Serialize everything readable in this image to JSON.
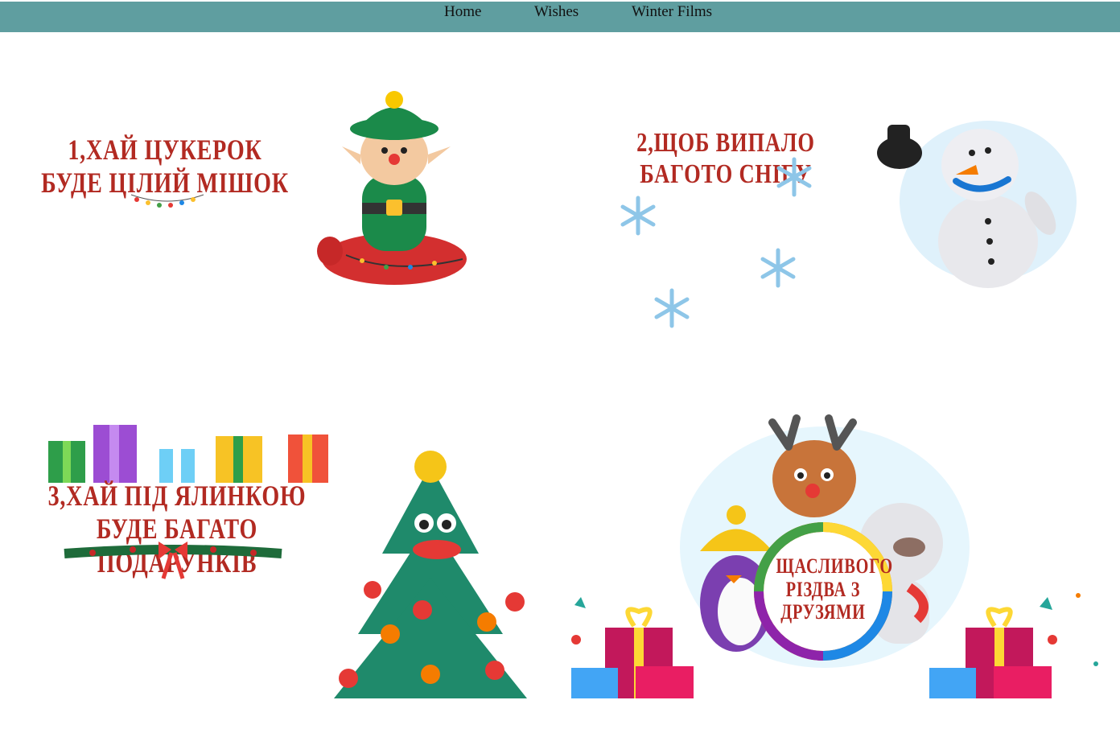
{
  "nav": {
    "items": [
      {
        "label": "Home"
      },
      {
        "label": "Wishes"
      },
      {
        "label": "Winter Films"
      }
    ]
  },
  "cards": [
    {
      "text": "1,ХАЙ ЦУКЕРОК БУДЕ ЦІЛИЙ МІШОК",
      "picture": "plasticine-elf-on-sack"
    },
    {
      "text": "2,ЩОБ ВИПАЛО БАГОТО СНІГУ",
      "picture": "plasticine-snowman-with-hat"
    },
    {
      "text": "3,ХАЙ ПІД ЯЛИНКОЮ БУДЕ БАГАТО ПОДАРУНКІВ",
      "picture": "plasticine-christmas-tree"
    },
    {
      "text": "ЩАСЛИВОГО РІЗДВА З ДРУЗЯМИ",
      "picture": "plasticine-deer-penguin-bear-with-gifts"
    }
  ],
  "colors": {
    "nav_bg": "#5f9ea0",
    "wish_text": "#b22a22",
    "snowflake": "#8ec6e8"
  }
}
